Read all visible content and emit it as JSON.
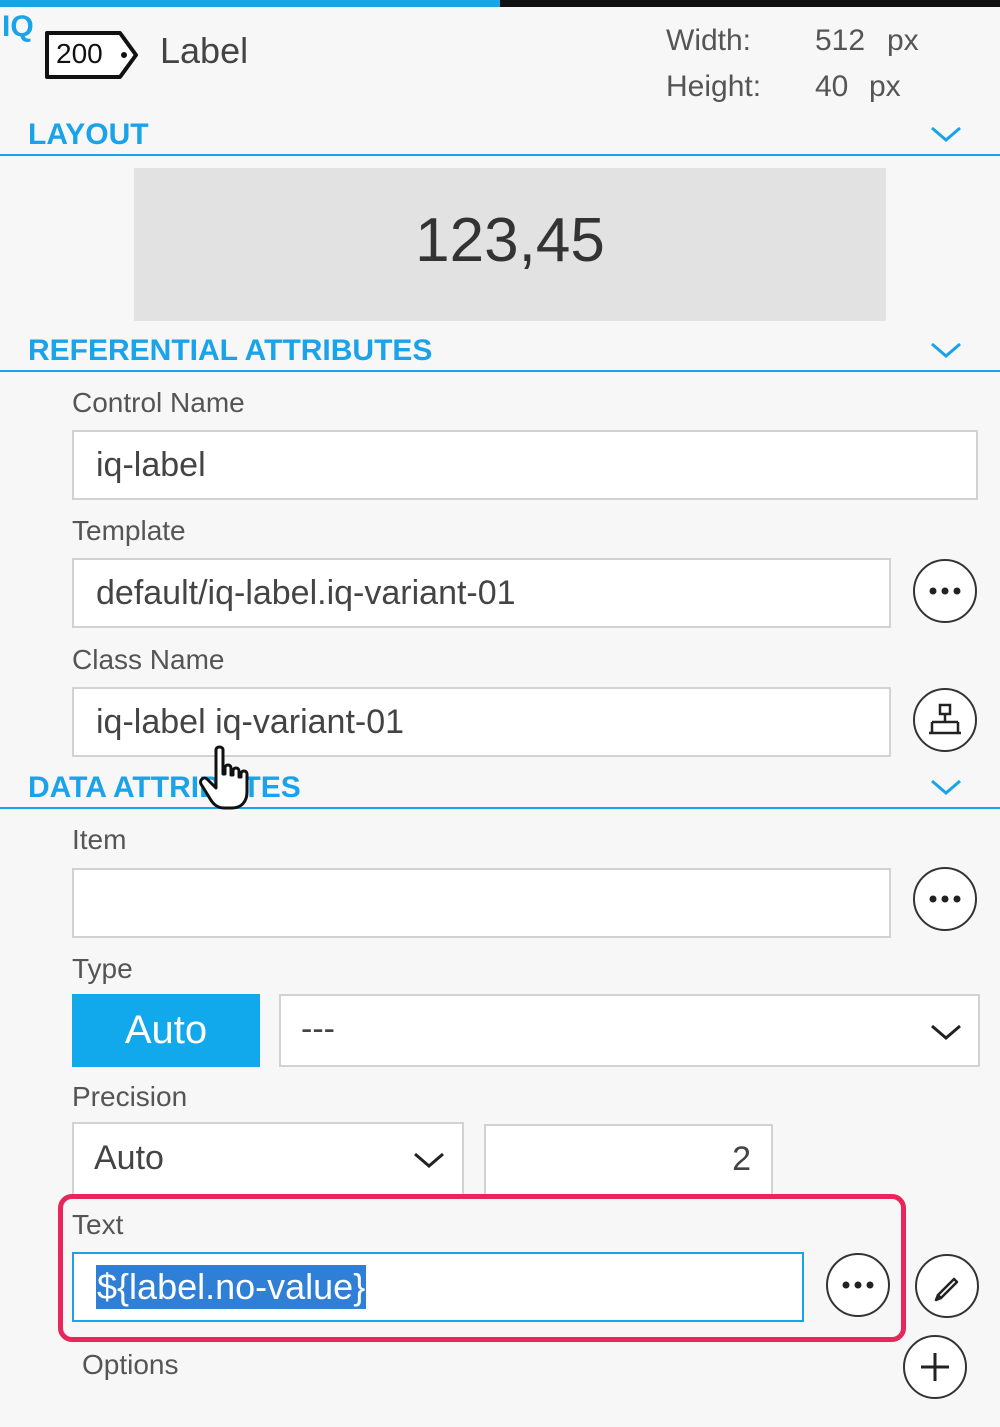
{
  "header": {
    "logo": "IQ",
    "badge": "200",
    "component_title": "Label",
    "width_label": "Width:",
    "width_value": "512",
    "width_unit": "px",
    "height_label": "Height:",
    "height_value": "40",
    "height_unit": "px",
    "progress_fraction": 0.5
  },
  "layout": {
    "title": "LAYOUT",
    "preview_value": "123,45"
  },
  "referential": {
    "title": "REFERENTIAL ATTRIBUTES",
    "control_name_label": "Control Name",
    "control_name_value": "iq-label",
    "template_label": "Template",
    "template_value": "default/iq-label.iq-variant-01",
    "class_name_label": "Class Name",
    "class_name_value": "iq-label iq-variant-01"
  },
  "data_attrs": {
    "title": "DATA ATTRIBUTES",
    "item_label": "Item",
    "item_value": "",
    "type_label": "Type",
    "type_button": "Auto",
    "type_select_value": "---",
    "precision_label": "Precision",
    "precision_select_value": "Auto",
    "precision_number": "2",
    "text_label": "Text",
    "text_value": "${label.no-value}",
    "options_label": "Options"
  },
  "colors": {
    "accent": "#1aa3e8",
    "auto_button": "#12a8ec",
    "highlight": "#e8265b",
    "selection": "#2f7fd6"
  },
  "icons": {
    "section_toggle": "chevron-down-icon",
    "more": "ellipsis-icon",
    "hierarchy": "hierarchy-icon",
    "edit": "pencil-icon",
    "add": "plus-icon",
    "cursor": "hand-pointer-icon"
  }
}
